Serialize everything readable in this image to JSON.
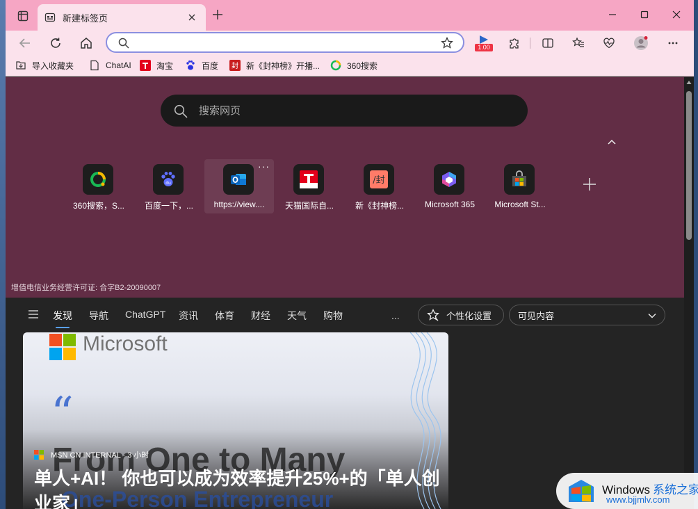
{
  "window": {
    "tab_title": "新建标签页"
  },
  "toolbar": {
    "address_value": "",
    "speed_badge": "1.00"
  },
  "favorites": [
    {
      "label": "导入收藏夹",
      "icon": "import-favorites-icon"
    },
    {
      "label": "ChatAI",
      "icon": "page-icon"
    },
    {
      "label": "淘宝",
      "icon": "tmall-icon"
    },
    {
      "label": "百度",
      "icon": "baidu-paw-icon"
    },
    {
      "label": "新《封神榜》开播...",
      "icon": "fengshen-icon"
    },
    {
      "label": "360搜索",
      "icon": "360-icon"
    }
  ],
  "ntp": {
    "search_placeholder": "搜索网页",
    "tiles": [
      {
        "label": "360搜索，S...",
        "icon": "360-icon"
      },
      {
        "label": "百度一下，...",
        "icon": "baidu-paw-icon"
      },
      {
        "label": "https://view....",
        "icon": "outlook-icon"
      },
      {
        "label": "天猫国际自...",
        "icon": "tmall-icon"
      },
      {
        "label": "新《封神榜...",
        "icon": "fengshen-icon"
      },
      {
        "label": "Microsoft 365",
        "icon": "m365-icon"
      },
      {
        "label": "Microsoft St...",
        "icon": "store-icon"
      }
    ],
    "license": "增值电信业务经营许可证: 合字B2-20090007"
  },
  "news_nav": {
    "tabs": [
      "发现",
      "导航",
      "ChatGPT",
      "资讯",
      "体育",
      "财经",
      "天气",
      "购物"
    ],
    "more": "...",
    "personalize": "个性化设置",
    "visible_content": "可见内容"
  },
  "card": {
    "brand": "Microsoft",
    "bg_line1": "From One to Many",
    "bg_line2": "One-Person Entrepreneur",
    "source": "MSN CN INTERNAL · 3 小时",
    "headline": "单人+AI！ 你也可以成为效率提升25%+的「单人创业家」"
  },
  "watermark": {
    "title": "Windows",
    "title_cn": "系统之家",
    "url": "www.bjjmlv.com"
  },
  "colors": {
    "titlebar": "#f6a6c4",
    "toolbar": "#fbe2ec",
    "ntp_background": "#622d45",
    "accent": "#59a0ff"
  }
}
